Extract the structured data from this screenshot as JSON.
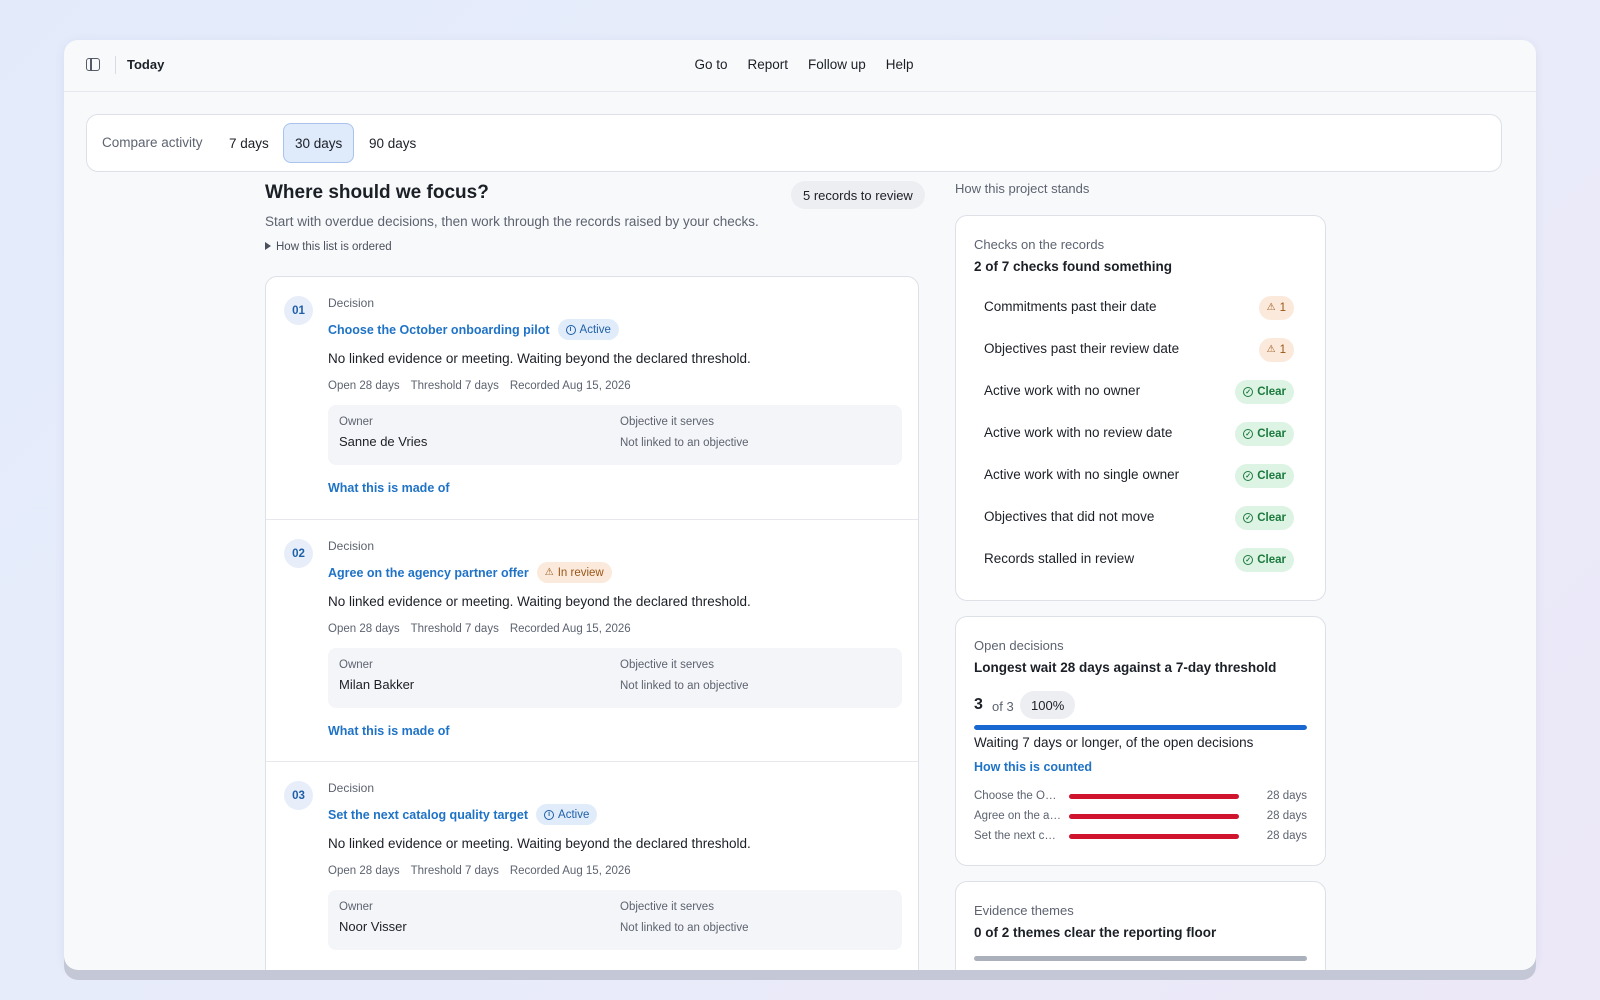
{
  "header": {
    "page_title": "Today",
    "nav": [
      "Go to",
      "Report",
      "Follow up",
      "Help"
    ]
  },
  "compare": {
    "label": "Compare activity",
    "periods": [
      "7 days",
      "30 days",
      "90 days"
    ],
    "selected": "30 days"
  },
  "focus": {
    "title": "Where should we focus?",
    "records_badge": "5 records to review",
    "subtitle": "Start with overdue decisions, then work through the records raised by your checks.",
    "order_toggle": "How this list is ordered",
    "items": [
      {
        "num": "01",
        "kind": "Decision",
        "title": "Choose the October onboarding pilot",
        "status": "Active",
        "status_type": "active",
        "desc": "No linked evidence or meeting. Waiting beyond the declared threshold.",
        "open": "Open 28 days",
        "threshold": "Threshold 7 days",
        "recorded": "Recorded Aug 15, 2026",
        "owner_label": "Owner",
        "owner": "Sanne de Vries",
        "objective_label": "Objective it serves",
        "objective": "Not linked to an objective",
        "link": "What this is made of"
      },
      {
        "num": "02",
        "kind": "Decision",
        "title": "Agree on the agency partner offer",
        "status": "In review",
        "status_type": "review",
        "desc": "No linked evidence or meeting. Waiting beyond the declared threshold.",
        "open": "Open 28 days",
        "threshold": "Threshold 7 days",
        "recorded": "Recorded Aug 15, 2026",
        "owner_label": "Owner",
        "owner": "Milan Bakker",
        "objective_label": "Objective it serves",
        "objective": "Not linked to an objective",
        "link": "What this is made of"
      },
      {
        "num": "03",
        "kind": "Decision",
        "title": "Set the next catalog quality target",
        "status": "Active",
        "status_type": "active",
        "desc": "No linked evidence or meeting. Waiting beyond the declared threshold.",
        "open": "Open 28 days",
        "threshold": "Threshold 7 days",
        "recorded": "Recorded Aug 15, 2026",
        "owner_label": "Owner",
        "owner": "Noor Visser",
        "objective_label": "Objective it serves",
        "objective": "Not linked to an objective",
        "link": "What this is made of"
      }
    ]
  },
  "stands": {
    "title": "How this project stands",
    "checks": {
      "label": "Checks on the records",
      "headline": "2 of 7 checks found something",
      "rows": [
        {
          "name": "Commitments past their date",
          "badge": "1",
          "type": "warn"
        },
        {
          "name": "Objectives past their review date",
          "badge": "1",
          "type": "warn"
        },
        {
          "name": "Active work with no owner",
          "badge": "Clear",
          "type": "clear"
        },
        {
          "name": "Active work with no review date",
          "badge": "Clear",
          "type": "clear"
        },
        {
          "name": "Active work with no single owner",
          "badge": "Clear",
          "type": "clear"
        },
        {
          "name": "Objectives that did not move",
          "badge": "Clear",
          "type": "clear"
        },
        {
          "name": "Records stalled in review",
          "badge": "Clear",
          "type": "clear"
        }
      ]
    },
    "decisions": {
      "label": "Open decisions",
      "headline": "Longest wait 28 days against a 7-day threshold",
      "count": "3",
      "of_total": "of 3",
      "percent": "100%",
      "progress": 1.0,
      "waiting_text": "Waiting 7 days or longer, of the open decisions",
      "how_counted": "How this is counted",
      "bars": [
        {
          "name": "Choose the October onboarding pilot",
          "value": 28,
          "label": "28 days"
        },
        {
          "name": "Agree on the agency partner offer",
          "value": 28,
          "label": "28 days"
        },
        {
          "name": "Set the next catalog quality target",
          "value": 28,
          "label": "28 days"
        }
      ]
    },
    "themes": {
      "label": "Evidence themes",
      "headline": "0 of 2 themes clear the reporting floor"
    }
  },
  "colors": {
    "accent": "#1f73c6",
    "progress": "#1968d2",
    "overdue_bar": "#d0142d",
    "clear_bg": "#ddf3e4",
    "warn_bg": "#fbeadc"
  }
}
